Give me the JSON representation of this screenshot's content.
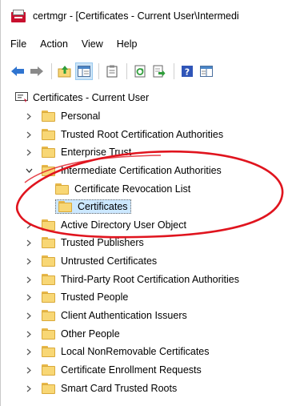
{
  "window": {
    "title": "certmgr - [Certificates - Current User\\Intermedi"
  },
  "menu": {
    "items": [
      "File",
      "Action",
      "View",
      "Help"
    ]
  },
  "toolbar": {
    "buttons": [
      "back-arrow-icon",
      "forward-arrow-icon",
      "up-folder-icon",
      "show-hide-tree-icon",
      "clipboard-icon",
      "refresh-icon",
      "export-list-icon",
      "help-icon",
      "properties-icon"
    ]
  },
  "tree": {
    "root": "Certificates - Current User",
    "items": [
      "Personal",
      "Trusted Root Certification Authorities",
      "Enterprise Trust",
      "Intermediate Certification Authorities",
      "Certificate Revocation List",
      "Certificates",
      "Active Directory User Object",
      "Trusted Publishers",
      "Untrusted Certificates",
      "Third-Party Root Certification Authorities",
      "Trusted People",
      "Client Authentication Issuers",
      "Other People",
      "Local NonRemovable Certificates",
      "Certificate Enrollment Requests",
      "Smart Card Trusted Roots"
    ],
    "selected": "Certificates",
    "expanded": "Intermediate Certification Authorities"
  },
  "colors": {
    "annotation": "#e0141e",
    "selection": "#cce8ff",
    "folder": "#f8d775"
  }
}
